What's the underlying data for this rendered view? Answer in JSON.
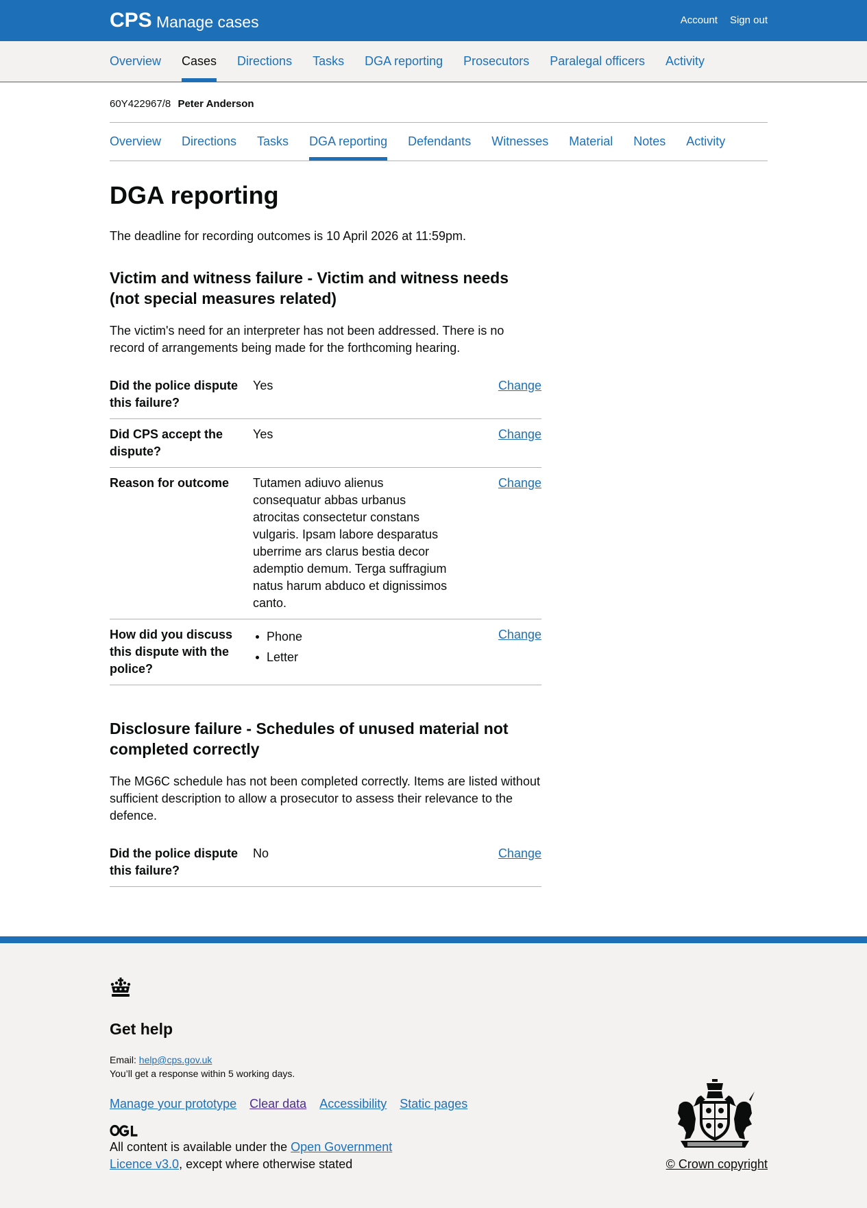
{
  "header": {
    "logo": "CPS",
    "service_name": "Manage cases",
    "account_label": "Account",
    "signout_label": "Sign out"
  },
  "primary_nav": [
    {
      "label": "Overview",
      "active": false
    },
    {
      "label": "Cases",
      "active": true
    },
    {
      "label": "Directions",
      "active": false
    },
    {
      "label": "Tasks",
      "active": false
    },
    {
      "label": "DGA reporting",
      "active": false
    },
    {
      "label": "Prosecutors",
      "active": false
    },
    {
      "label": "Paralegal officers",
      "active": false
    },
    {
      "label": "Activity",
      "active": false
    }
  ],
  "case": {
    "reference": "60Y422967/8",
    "defendant_name": "Peter Anderson"
  },
  "sub_nav": [
    {
      "label": "Overview",
      "active": false
    },
    {
      "label": "Directions",
      "active": false
    },
    {
      "label": "Tasks",
      "active": false
    },
    {
      "label": "DGA reporting",
      "active": true
    },
    {
      "label": "Defendants",
      "active": false
    },
    {
      "label": "Witnesses",
      "active": false
    },
    {
      "label": "Material",
      "active": false
    },
    {
      "label": "Notes",
      "active": false
    },
    {
      "label": "Activity",
      "active": false
    }
  ],
  "page": {
    "title": "DGA reporting",
    "deadline_text": "The deadline for recording outcomes is 10 April 2026 at 11:59pm."
  },
  "failures": [
    {
      "heading": "Victim and witness failure - Victim and witness needs (not special measures related)",
      "description": "The victim's need for an interpreter has not been addressed. There is no record of arrangements being made for the forthcoming hearing.",
      "change_label": "Change",
      "rows": [
        {
          "key": "Did the police dispute this failure?",
          "value": "Yes"
        },
        {
          "key": "Did CPS accept the dispute?",
          "value": "Yes"
        },
        {
          "key": "Reason for outcome",
          "value": "Tutamen adiuvo alienus consequatur abbas urbanus atrocitas consectetur constans vulgaris. Ipsam labore desparatus uberrime ars clarus bestia decor ademptio demum. Terga suffragium natus harum abduco et dignissimos canto."
        },
        {
          "key": "How did you discuss this dispute with the police?",
          "list": [
            "Phone",
            "Letter"
          ]
        }
      ]
    },
    {
      "heading": "Disclosure failure - Schedules of unused material not completed correctly",
      "description": "The MG6C schedule has not been completed correctly. Items are listed without sufficient description to allow a prosecutor to assess their relevance to the defence.",
      "change_label": "Change",
      "rows": [
        {
          "key": "Did the police dispute this failure?",
          "value": "No"
        }
      ]
    }
  ],
  "footer": {
    "help_title": "Get help",
    "email_label": "Email:",
    "email": "help@cps.gov.uk",
    "response_text": "You’ll get a response within 5 working days.",
    "links": [
      {
        "label": "Manage your prototype",
        "visited": false
      },
      {
        "label": "Clear data",
        "visited": true
      },
      {
        "label": "Accessibility",
        "visited": false
      },
      {
        "label": "Static pages",
        "visited": false
      }
    ],
    "licence_prefix": "All content is available under the ",
    "licence_link": "Open Government Licence v3.0",
    "licence_suffix": ", except where otherwise stated",
    "copyright": "© Crown copyright"
  }
}
